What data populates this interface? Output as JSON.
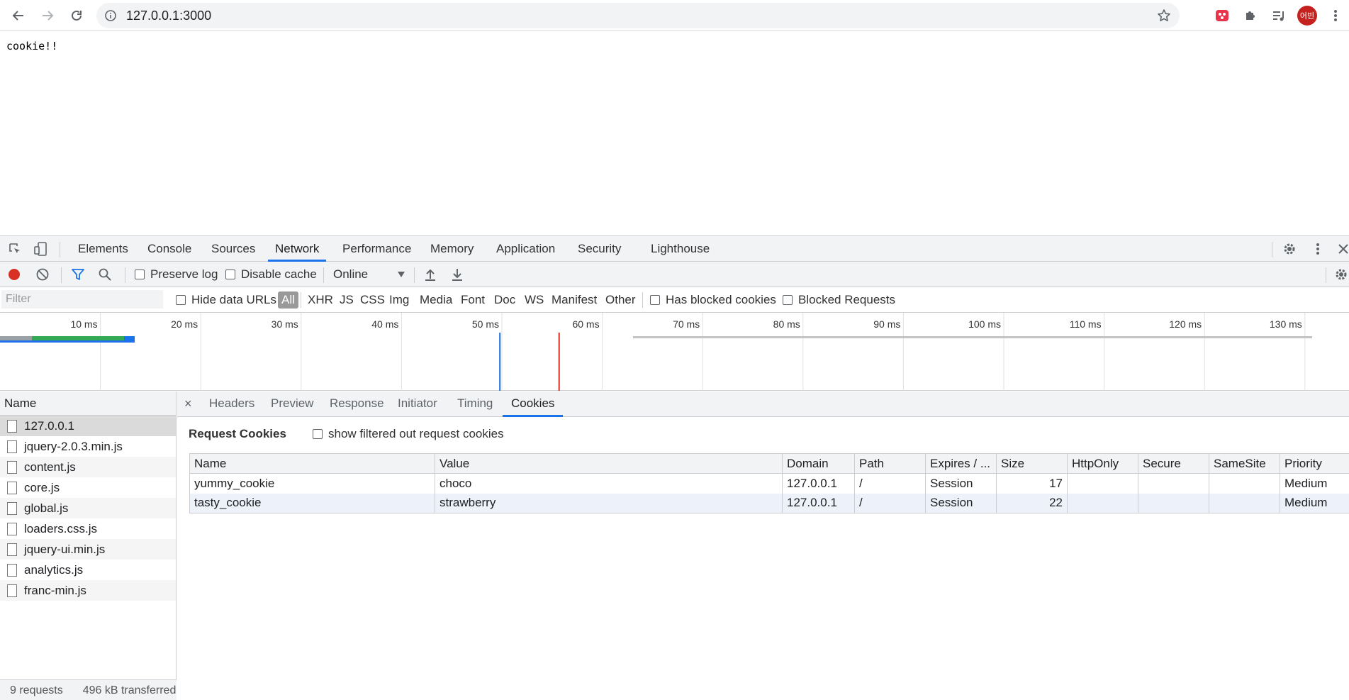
{
  "browser": {
    "url": "127.0.0.1:3000",
    "avatar_text": "어빈",
    "icons": {
      "back": "arrow-left-icon",
      "forward": "arrow-right-icon",
      "reload": "reload-icon",
      "info": "info-icon",
      "bookmark": "star-icon",
      "extension_1": "gift-icon",
      "extensions": "puzzle-icon",
      "media": "queue-music-icon",
      "menu": "vertical-dots-icon"
    }
  },
  "page": {
    "text": "cookie!!"
  },
  "devtools": {
    "tabs": [
      "Elements",
      "Console",
      "Sources",
      "Network",
      "Performance",
      "Memory",
      "Application",
      "Security",
      "Lighthouse"
    ],
    "active_tab": "Network",
    "network_toolbar": {
      "preserve_log": "Preserve log",
      "disable_cache": "Disable cache",
      "throttling": "Online"
    },
    "filter": {
      "placeholder": "Filter",
      "hide_data_urls": "Hide data URLs",
      "types": [
        "All",
        "XHR",
        "JS",
        "CSS",
        "Img",
        "Media",
        "Font",
        "Doc",
        "WS",
        "Manifest",
        "Other"
      ],
      "has_blocked_cookies": "Has blocked cookies",
      "blocked_requests": "Blocked Requests"
    },
    "overview": {
      "ticks": [
        "10 ms",
        "20 ms",
        "30 ms",
        "40 ms",
        "50 ms",
        "60 ms",
        "70 ms",
        "80 ms",
        "90 ms",
        "100 ms",
        "110 ms",
        "120 ms",
        "130 ms"
      ],
      "dom_content_loaded_ms": 50,
      "load_ms": 56
    },
    "requests": {
      "header": "Name",
      "items": [
        "127.0.0.1",
        "jquery-2.0.3.min.js",
        "content.js",
        "core.js",
        "global.js",
        "loaders.css.js",
        "jquery-ui.min.js",
        "analytics.js",
        "franc-min.js"
      ],
      "status_requests": "9 requests",
      "status_transferred": "496 kB transferred"
    },
    "detail": {
      "close": "×",
      "tabs": [
        "Headers",
        "Preview",
        "Response",
        "Initiator",
        "Timing",
        "Cookies"
      ],
      "active_tab": "Cookies",
      "request_cookies_title": "Request Cookies",
      "show_filtered": "show filtered out request cookies",
      "columns": [
        "Name",
        "Value",
        "Domain",
        "Path",
        "Expires / ...",
        "Size",
        "HttpOnly",
        "Secure",
        "SameSite",
        "Priority"
      ],
      "rows": [
        [
          "yummy_cookie",
          "choco",
          "127.0.0.1",
          "/",
          "Session",
          "17",
          "",
          "",
          "",
          "Medium"
        ],
        [
          "tasty_cookie",
          "strawberry",
          "127.0.0.1",
          "/",
          "Session",
          "22",
          "",
          "",
          "",
          "Medium"
        ]
      ]
    },
    "colors": {
      "accent": "#1a73e8",
      "record": "#d93025",
      "dom_content_loaded_line": "#1a73e8",
      "load_line": "#d93025"
    }
  }
}
